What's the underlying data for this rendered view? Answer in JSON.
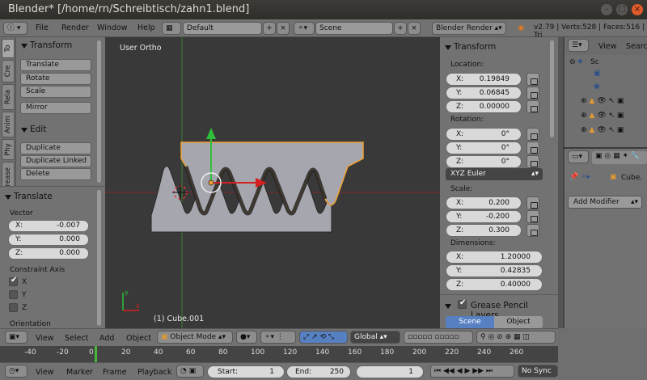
{
  "window": {
    "title": "Blender* [/home/rn/Schreibtisch/zahn1.blend]"
  },
  "info_header": {
    "menus": [
      "File",
      "Render",
      "Window",
      "Help"
    ],
    "layout": "Default",
    "scene": "Scene",
    "engine": "Blender Render",
    "stats": "v2.79 | Verts:528 | Faces:516 | Tri"
  },
  "tool_tabs": [
    "To",
    "Cre",
    "Rela",
    "Anim",
    "Phy",
    "Grease"
  ],
  "toolshelf": {
    "transform_title": "Transform",
    "transform_buttons": [
      "Translate",
      "Rotate",
      "Scale"
    ],
    "mirror": "Mirror",
    "edit_title": "Edit",
    "edit_buttons": [
      "Duplicate",
      "Duplicate Linked",
      "Delete"
    ]
  },
  "operator_panel": {
    "title": "Translate",
    "vector_label": "Vector",
    "vector": [
      {
        "axis": "X:",
        "value": "-0.007"
      },
      {
        "axis": "Y:",
        "value": "0.000"
      },
      {
        "axis": "Z:",
        "value": "0.000"
      }
    ],
    "constraint_label": "Constraint Axis",
    "constraints": [
      {
        "axis": "X",
        "checked": true
      },
      {
        "axis": "Y",
        "checked": false
      },
      {
        "axis": "Z",
        "checked": false
      }
    ],
    "orientation_label": "Orientation"
  },
  "viewport": {
    "view_name": "User Ortho",
    "object_info": "(1) Cube.001",
    "colors": {
      "background": "#393939",
      "mesh": "#a5a6ae",
      "selection": "#f0a030",
      "x_axis": "#c0242a",
      "y_axis": "#5aa02c"
    }
  },
  "transform_panel": {
    "title": "Transform",
    "location_label": "Location:",
    "location": [
      {
        "axis": "X:",
        "value": "0.19849"
      },
      {
        "axis": "Y:",
        "value": "0.06845"
      },
      {
        "axis": "Z:",
        "value": "0.00000"
      }
    ],
    "rotation_label": "Rotation:",
    "rotation": [
      {
        "axis": "X:",
        "value": "0°"
      },
      {
        "axis": "Y:",
        "value": "0°"
      },
      {
        "axis": "Z:",
        "value": "0°"
      }
    ],
    "rotation_mode": "XYZ Euler",
    "scale_label": "Scale:",
    "scale": [
      {
        "axis": "X:",
        "value": "0.200"
      },
      {
        "axis": "Y:",
        "value": "-0.200"
      },
      {
        "axis": "Z:",
        "value": "0.300"
      }
    ],
    "dimensions_label": "Dimensions:",
    "dimensions": [
      {
        "axis": "X:",
        "value": "1.20000"
      },
      {
        "axis": "Y:",
        "value": "0.42835"
      },
      {
        "axis": "Z:",
        "value": "0.40000"
      }
    ],
    "grease_pencil_label": "Grease Pencil Layers",
    "gp_tabs": [
      "Scene",
      "Object"
    ]
  },
  "outliner": {
    "view_menu": "View",
    "search_menu": "Searc",
    "items": [
      "Sc"
    ]
  },
  "properties": {
    "object_name": "Cube.",
    "add_modifier": "Add Modifier"
  },
  "view3d_header": {
    "menus": [
      "View",
      "Select",
      "Add",
      "Object"
    ],
    "mode": "Object Mode",
    "orientation": "Global"
  },
  "timeline": {
    "ticks": [
      "-40",
      "-20",
      "0",
      "20",
      "40",
      "60",
      "80",
      "100",
      "120",
      "140",
      "160",
      "180",
      "200",
      "220",
      "240",
      "260"
    ],
    "current_frame": 1
  },
  "timeline_header": {
    "menus": [
      "View",
      "Marker",
      "Frame",
      "Playback"
    ],
    "start": {
      "label": "Start:",
      "value": "1"
    },
    "end": {
      "label": "End:",
      "value": "250"
    },
    "current": "1",
    "sync": "No Sync"
  }
}
